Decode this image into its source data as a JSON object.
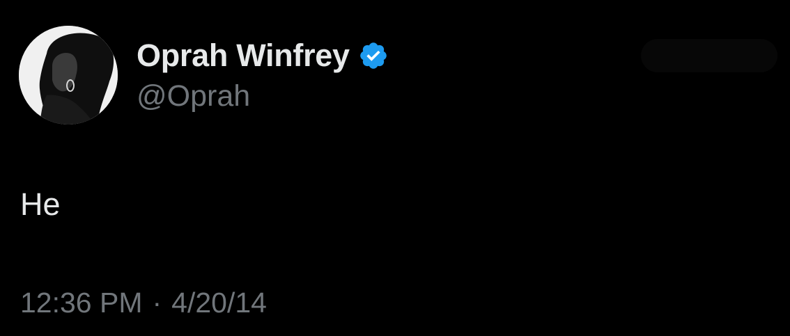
{
  "tweet": {
    "author": {
      "display_name": "Oprah Winfrey",
      "handle": "@Oprah",
      "verified_icon": "verified-badge-icon",
      "avatar_icon": "profile-photo-avatar"
    },
    "text": "He",
    "timestamp": {
      "time": "12:36 PM",
      "separator": "·",
      "date": "4/20/14"
    }
  },
  "colors": {
    "background": "#000000",
    "primary_text": "#e7e9ea",
    "secondary_text": "#71767b",
    "verified_blue": "#1d9bf0"
  }
}
